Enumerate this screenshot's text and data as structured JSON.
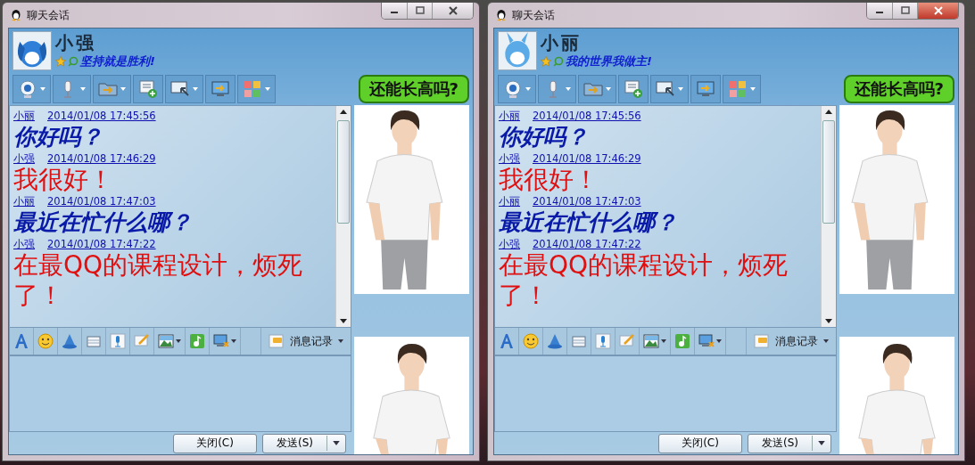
{
  "windows": [
    {
      "title": "聊天会话",
      "active": false,
      "contact": {
        "name": "小强",
        "signature": "坚持就是胜利!"
      },
      "ad": "还能长高吗?",
      "messages": [
        {
          "sender": "小丽",
          "time": "2014/01/08 17:45:56",
          "text": "你好吗？",
          "kind": "script"
        },
        {
          "sender": "小强",
          "time": "2014/01/08 17:46:29",
          "text": "我很好！",
          "kind": "plain"
        },
        {
          "sender": "小丽",
          "time": "2014/01/08 17:47:03",
          "text": "最近在忙什么哪？",
          "kind": "script"
        },
        {
          "sender": "小强",
          "time": "2014/01/08 17:47:22",
          "text": "在最QQ的课程设计，烦死了！",
          "kind": "plain"
        }
      ],
      "history_button": "消息记录",
      "close_button": "关闭(C)",
      "send_button": "发送(S)"
    },
    {
      "title": "聊天会话",
      "active": true,
      "contact": {
        "name": "小丽",
        "signature": "我的世界我做主!"
      },
      "ad": "还能长高吗?",
      "messages": [
        {
          "sender": "小丽",
          "time": "2014/01/08 17:45:56",
          "text": "你好吗？",
          "kind": "script"
        },
        {
          "sender": "小强",
          "time": "2014/01/08 17:46:29",
          "text": "我很好！",
          "kind": "plain"
        },
        {
          "sender": "小丽",
          "time": "2014/01/08 17:47:03",
          "text": "最近在忙什么哪？",
          "kind": "script"
        },
        {
          "sender": "小强",
          "time": "2014/01/08 17:47:22",
          "text": "在最QQ的课程设计，烦死了！",
          "kind": "plain"
        }
      ],
      "history_button": "消息记录",
      "close_button": "关闭(C)",
      "send_button": "发送(S)"
    }
  ]
}
